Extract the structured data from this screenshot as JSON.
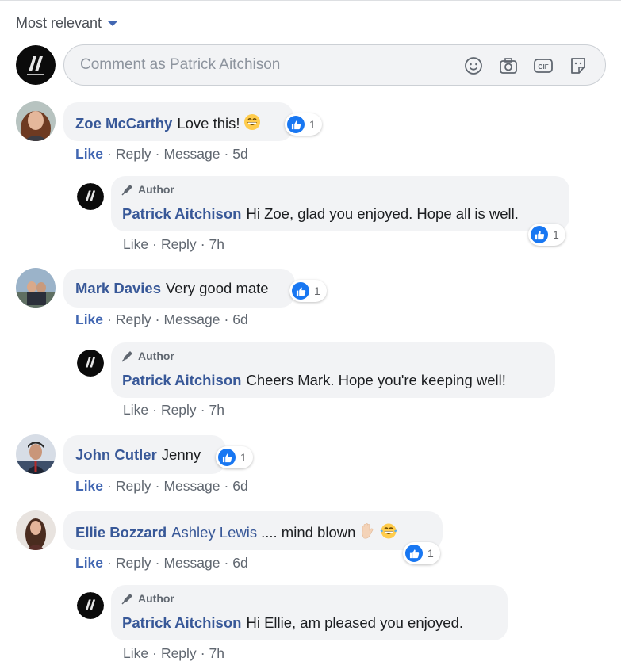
{
  "sort": {
    "label": "Most relevant"
  },
  "composer": {
    "placeholder": "Comment as Patrick Aitchison"
  },
  "author_badge": "Author",
  "actions": {
    "like": "Like",
    "reply": "Reply",
    "message": "Message",
    "sep": "·"
  },
  "colors": {
    "link": "#385898",
    "like_blue": "#1877f2",
    "bubble": "#f2f3f5"
  },
  "comments": [
    {
      "name": "Zoe McCarthy",
      "text": "Love this!",
      "emoji": "grinning-face",
      "likes": "1",
      "time": "5d",
      "reply": {
        "name": "Patrick Aitchison",
        "text": "Hi Zoe, glad you enjoyed. Hope all is well.",
        "likes": "1",
        "time": "7h"
      }
    },
    {
      "name": "Mark Davies",
      "text": "Very good mate",
      "likes": "1",
      "time": "6d",
      "reply": {
        "name": "Patrick Aitchison",
        "text": "Cheers Mark. Hope you're keeping well!",
        "time": "7h"
      }
    },
    {
      "name": "John Cutler",
      "text": "Jenny",
      "likes": "1",
      "time": "6d"
    },
    {
      "name": "Ellie Bozzard",
      "tag": "Ashley Lewis",
      "text": ".... mind blown",
      "emoji": "raised-hand, tears-of-joy",
      "likes": "1",
      "time": "6d",
      "reply": {
        "name": "Patrick Aitchison",
        "text": "Hi Ellie, am pleased you enjoyed.",
        "time": "7h"
      }
    }
  ]
}
